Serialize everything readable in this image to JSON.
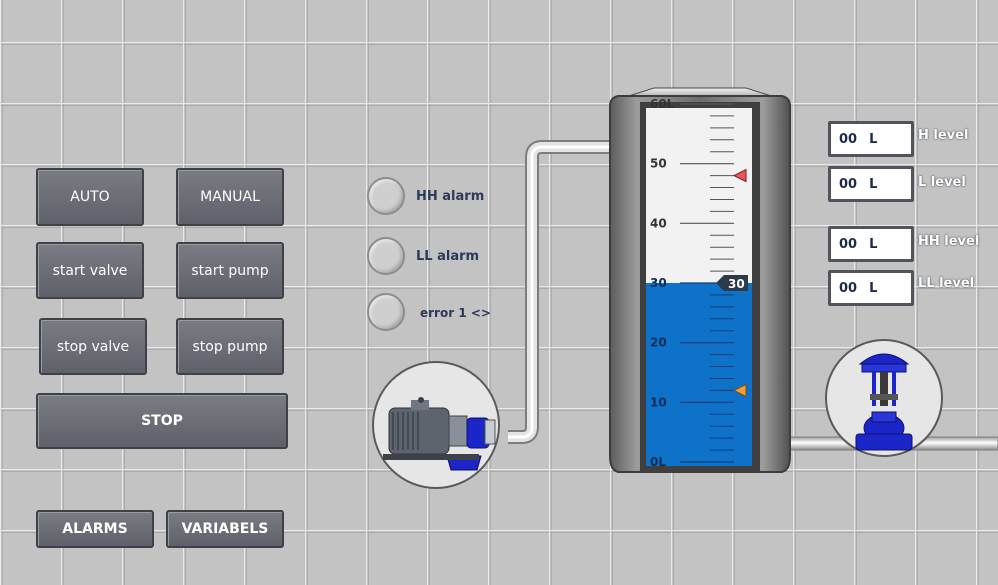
{
  "buttons": {
    "auto": "AUTO",
    "manual": "MANUAL",
    "start_valve": "start valve",
    "start_pump": "start pump",
    "stop_valve": "stop valve",
    "stop_pump": "stop pump",
    "stop": "STOP",
    "alarms": "ALARMS",
    "variables": "VARIABELS"
  },
  "indicators": {
    "hh_alarm": "HH alarm",
    "ll_alarm": "LL alarm",
    "error": "error 1 <>"
  },
  "setpoints": [
    {
      "value": "00",
      "unit": "L",
      "label": "H level"
    },
    {
      "value": "00",
      "unit": "L",
      "label": "L level"
    },
    {
      "value": "00",
      "unit": "L",
      "label": "HH level"
    },
    {
      "value": "00",
      "unit": "L",
      "label": "LL level"
    }
  ],
  "tank": {
    "level": 30,
    "level_label": "30",
    "scale_min": 0,
    "scale_max": 60,
    "scale_labels": [
      "0L",
      "10",
      "20",
      "30",
      "40",
      "50",
      "60L"
    ],
    "high_marker": 48,
    "low_marker": 12,
    "water_color": "#0f72c9",
    "high_marker_color": "#e8545a",
    "low_marker_color": "#f0a030"
  },
  "icons": {
    "pump": "pump-icon",
    "valve": "control-valve-icon"
  }
}
